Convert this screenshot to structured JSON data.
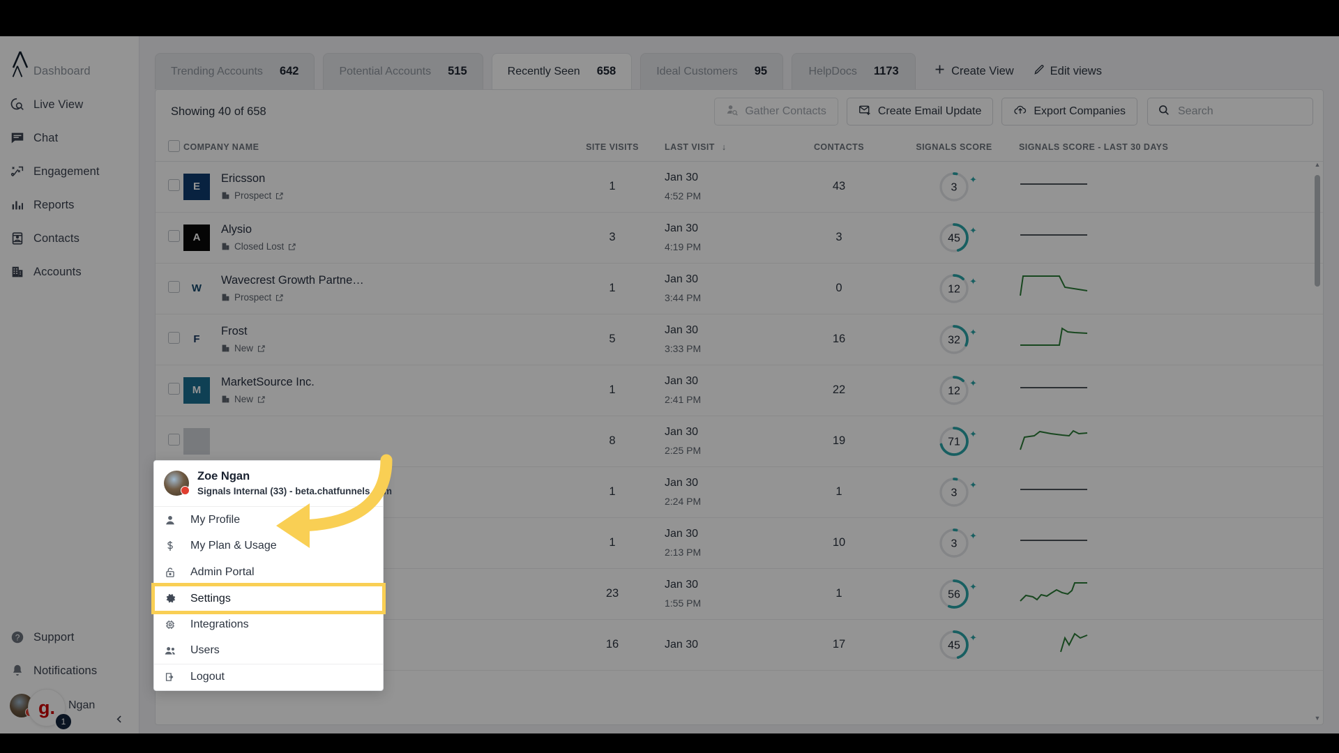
{
  "app": {
    "brand_logo": "signals-lambda-logo",
    "accent": "#f9cf54",
    "teal": "#2aa4a8",
    "green": "#2a7a36"
  },
  "sidebar": {
    "items": [
      {
        "label": "Dashboard",
        "icon": "lambda-icon",
        "muted": true
      },
      {
        "label": "Live View",
        "icon": "live-view-icon",
        "muted": false
      },
      {
        "label": "Chat",
        "icon": "chat-icon",
        "muted": false
      },
      {
        "label": "Engagement",
        "icon": "engagement-icon",
        "muted": false
      },
      {
        "label": "Reports",
        "icon": "reports-icon",
        "muted": false
      },
      {
        "label": "Contacts",
        "icon": "contacts-icon",
        "muted": false
      },
      {
        "label": "Accounts",
        "icon": "accounts-icon",
        "muted": false
      }
    ],
    "bottom": [
      {
        "label": "Support",
        "icon": "help-circle-icon"
      },
      {
        "label": "Notifications",
        "icon": "bell-icon"
      }
    ],
    "account": {
      "name": "Ngan",
      "badge": "1",
      "bubble_letter": "g.",
      "avatar": "user-avatar"
    },
    "collapse_icon": "chevron-left-icon"
  },
  "tabs": [
    {
      "label": "Trending Accounts",
      "count": "642",
      "active": false
    },
    {
      "label": "Potential Accounts",
      "count": "515",
      "active": false
    },
    {
      "label": "Recently Seen",
      "count": "658",
      "active": true
    },
    {
      "label": "Ideal Customers",
      "count": "95",
      "active": false
    },
    {
      "label": "HelpDocs",
      "count": "1173",
      "active": false
    }
  ],
  "tab_actions": [
    {
      "label": "Create View",
      "icon": "plus-icon"
    },
    {
      "label": "Edit views",
      "icon": "pencil-icon"
    }
  ],
  "toolbar": {
    "showing": "Showing 40 of  658",
    "gather_contacts": "Gather Contacts",
    "create_email_update": "Create Email Update",
    "export_companies": "Export Companies",
    "search_placeholder": "Search",
    "search_value": ""
  },
  "table": {
    "columns": [
      "COMPANY NAME",
      "SITE VISITS",
      "LAST VISIT",
      "CONTACTS",
      "SIGNALS SCORE",
      "SIGNALS SCORE - LAST 30 DAYS"
    ],
    "sort_column": "LAST VISIT",
    "sort_icon": "arrow-down-icon",
    "rows": [
      {
        "company": "Ericsson",
        "status": "Prospect",
        "visits": "1",
        "date": "Jan 30",
        "time": "4:52 PM",
        "contacts": "43",
        "score": 3,
        "logo_bg": "#0e3c6e",
        "logo_fg": "#ffffff",
        "logo_glyph": "E",
        "spark": "flat"
      },
      {
        "company": "Alysio",
        "status": "Closed Lost",
        "visits": "3",
        "date": "Jan 30",
        "time": "4:19 PM",
        "contacts": "3",
        "score": 45,
        "logo_bg": "#0a0a0a",
        "logo_fg": "#ffffff",
        "logo_glyph": "A",
        "spark": "flat"
      },
      {
        "company": "Wavecrest Growth Partne…",
        "status": "Prospect",
        "visits": "1",
        "date": "Jan 30",
        "time": "3:44 PM",
        "contacts": "0",
        "score": 12,
        "logo_bg": "#ffffff",
        "logo_fg": "#14486b",
        "logo_glyph": "W",
        "spark": "plateau-drop"
      },
      {
        "company": "Frost",
        "status": "New",
        "visits": "5",
        "date": "Jan 30",
        "time": "3:33 PM",
        "contacts": "16",
        "score": 32,
        "logo_bg": "#ffffff",
        "logo_fg": "#16355e",
        "logo_glyph": "F",
        "spark": "low-jump"
      },
      {
        "company": "MarketSource Inc.",
        "status": "New",
        "visits": "1",
        "date": "Jan 30",
        "time": "2:41 PM",
        "contacts": "22",
        "score": 12,
        "logo_bg": "#1b6e92",
        "logo_fg": "#ffffff",
        "logo_glyph": "M",
        "spark": "flat"
      },
      {
        "company": "",
        "status": "",
        "visits": "8",
        "date": "Jan 30",
        "time": "2:25 PM",
        "contacts": "19",
        "score": 71,
        "logo_bg": "#cfd3d8",
        "logo_fg": "#ffffff",
        "logo_glyph": "",
        "spark": "rising"
      },
      {
        "company": "",
        "status": "",
        "visits": "1",
        "date": "Jan 30",
        "time": "2:24 PM",
        "contacts": "1",
        "score": 3,
        "logo_bg": "#cfd3d8",
        "logo_fg": "#ffffff",
        "logo_glyph": "",
        "spark": "flat"
      },
      {
        "company": "",
        "status": "",
        "visits": "1",
        "date": "Jan 30",
        "time": "2:13 PM",
        "contacts": "10",
        "score": 3,
        "logo_bg": "#cfd3d8",
        "logo_fg": "#ffffff",
        "logo_glyph": "",
        "spark": "flat"
      },
      {
        "company": "",
        "status": "",
        "visits": "23",
        "date": "Jan 30",
        "time": "1:55 PM",
        "contacts": "1",
        "score": 56,
        "logo_bg": "#cfd3d8",
        "logo_fg": "#ffffff",
        "logo_glyph": "",
        "spark": "zigzag-up"
      },
      {
        "company": "",
        "status": "",
        "visits": "16",
        "date": "Jan 30",
        "time": "",
        "contacts": "17",
        "score": 45,
        "logo_bg": "#cfd3d8",
        "logo_fg": "#ffffff",
        "logo_glyph": "",
        "spark": "tail-spike"
      }
    ]
  },
  "user_menu": {
    "name": "Zoe Ngan",
    "org": "Signals Internal (33) - beta.chatfunnels.com",
    "items": [
      {
        "label": "My Profile",
        "icon": "person-icon",
        "highlighted": false,
        "sep": false
      },
      {
        "label": "My Plan & Usage",
        "icon": "dollar-icon",
        "highlighted": false,
        "sep": false
      },
      {
        "label": "Admin Portal",
        "icon": "lock-icon",
        "highlighted": false,
        "sep": false
      },
      {
        "label": "Settings",
        "icon": "gear-icon",
        "highlighted": true,
        "sep": true
      },
      {
        "label": "Integrations",
        "icon": "chip-icon",
        "highlighted": false,
        "sep": false
      },
      {
        "label": "Users",
        "icon": "users-icon",
        "highlighted": false,
        "sep": false
      },
      {
        "label": "Logout",
        "icon": "logout-icon",
        "highlighted": false,
        "sep": true
      }
    ]
  },
  "annotation": {
    "type": "curved-arrow",
    "color": "#f9cf54",
    "points_to": "Settings"
  }
}
